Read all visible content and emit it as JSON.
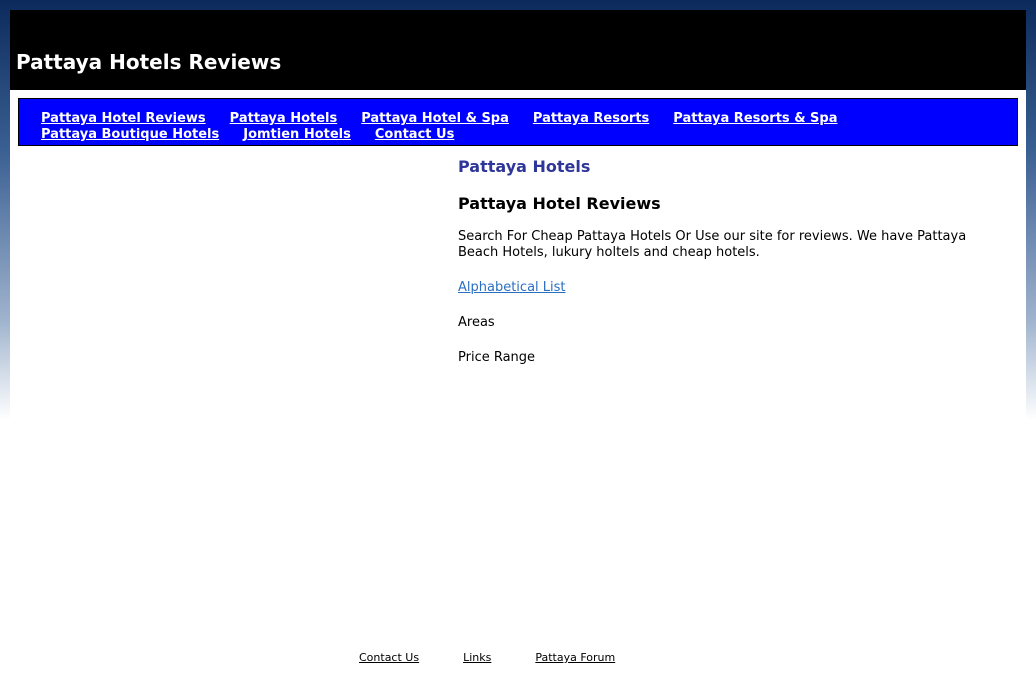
{
  "header": {
    "title": "Pattaya Hotels Reviews"
  },
  "nav": {
    "row1": [
      {
        "label": "Pattaya Hotel Reviews"
      },
      {
        "label": "Pattaya Hotels"
      },
      {
        "label": "Pattaya Hotel & Spa"
      },
      {
        "label": "Pattaya Resorts"
      },
      {
        "label": "Pattaya Resorts & Spa"
      }
    ],
    "row2": [
      {
        "label": "Pattaya Boutique Hotels"
      },
      {
        "label": "Jomtien Hotels"
      },
      {
        "label": "Contact Us"
      }
    ]
  },
  "main": {
    "heading": "Pattaya Hotels",
    "subheading": "Pattaya Hotel Reviews",
    "description": "Search For Cheap Pattaya Hotels Or Use our site for reviews. We have Pattaya Beach Hotels, lukury holtels and cheap hotels.",
    "alphabetical_link": "Alphabetical List",
    "areas": "Areas",
    "price_range": "Price Range"
  },
  "footer": {
    "links": [
      {
        "label": "Contact Us"
      },
      {
        "label": "Links"
      },
      {
        "label": "Pattaya Forum"
      }
    ]
  },
  "colors": {
    "header_bg": "#000000",
    "nav_bg": "#0000ff",
    "heading": "#2f3699",
    "link": "#2a6fc0"
  }
}
